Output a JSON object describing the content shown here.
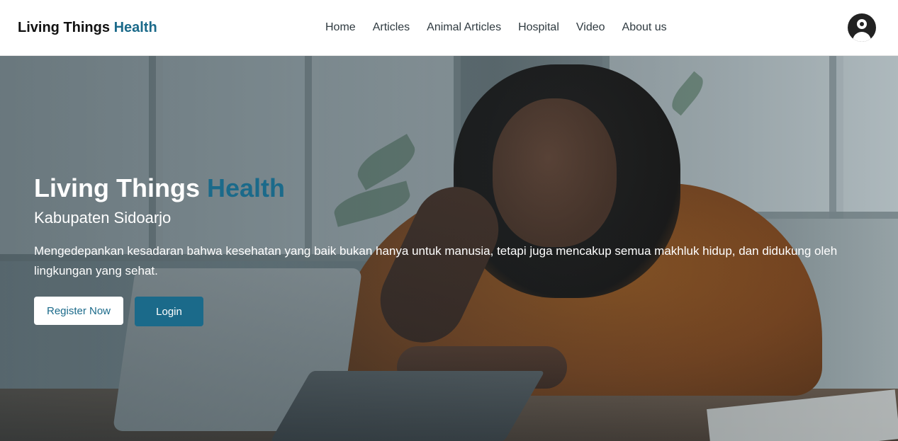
{
  "header": {
    "brand_main": "Living Things",
    "brand_accent": "Health",
    "nav": [
      "Home",
      "Articles",
      "Animal Articles",
      "Hospital",
      "Video",
      "About us"
    ],
    "profile_icon": "user-circle-icon"
  },
  "hero": {
    "title_main": "Living Things",
    "title_accent": "Health",
    "subtitle": "Kabupaten Sidoarjo",
    "description": "Mengedepankan kesadaran bahwa kesehatan yang baik bukan hanya untuk manusia, tetapi juga mencakup semua makhluk hidup, dan didukung oleh lingkungan yang sehat.",
    "register_label": "Register Now",
    "login_label": "Login"
  },
  "colors": {
    "accent": "#1b6a8a",
    "text_dark": "#111111",
    "white": "#ffffff"
  }
}
